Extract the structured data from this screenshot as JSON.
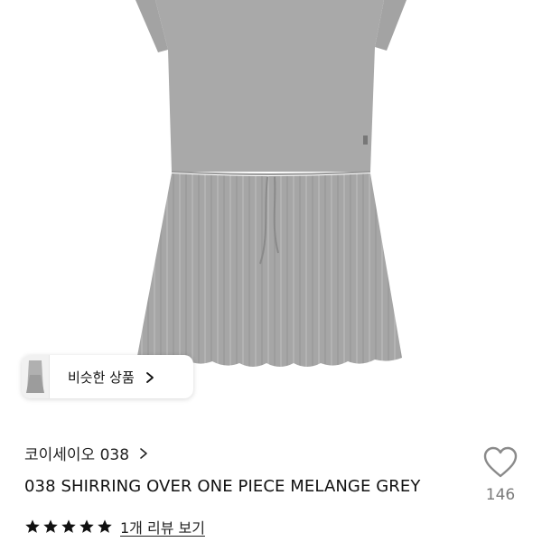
{
  "similar": {
    "label": "비슷한 상품"
  },
  "brand": {
    "name": "코이세이오 038"
  },
  "product": {
    "name": "038 SHIRRING OVER ONE PIECE MELANGE GREY"
  },
  "rating": {
    "stars": 5,
    "review_link": "1개 리뷰 보기"
  },
  "like": {
    "count": "146"
  },
  "colors": {
    "dress": "#a9a9a9",
    "star": "#111111",
    "like_count": "#7a7a7a"
  },
  "icons": [
    "chevron-right-icon",
    "heart-outline-icon",
    "star-icon"
  ]
}
